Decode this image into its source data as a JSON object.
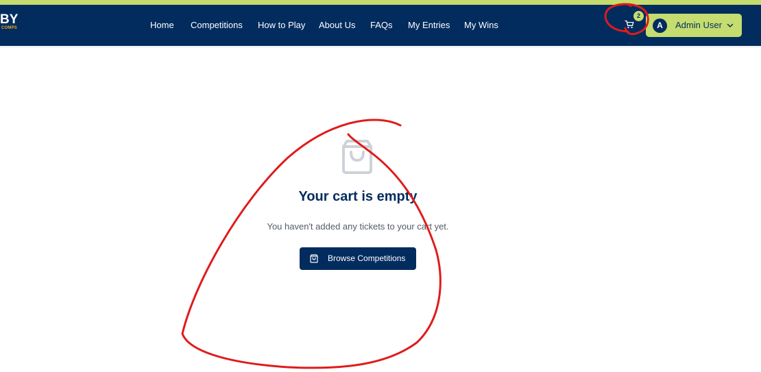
{
  "brand": {
    "logo_main": "BY",
    "logo_sub": "COMPS",
    "accent_color": "#c5dc6f",
    "nav_color": "#022c5e"
  },
  "nav": {
    "links": [
      "Home",
      "Competitions",
      "How to Play",
      "About Us",
      "FAQs",
      "My Entries",
      "My Wins"
    ]
  },
  "cart": {
    "icon": "cart-icon",
    "count": "2"
  },
  "user": {
    "initial": "A",
    "name": "Admin User",
    "icon": "chevron-down-icon"
  },
  "empty_state": {
    "icon": "shopping-bag-icon",
    "title": "Your cart is empty",
    "message": "You haven't added any tickets to your cart yet.",
    "button_label": "Browse Competitions",
    "button_icon": "shopping-bag-icon"
  },
  "annotation_color": "#e01b1b"
}
